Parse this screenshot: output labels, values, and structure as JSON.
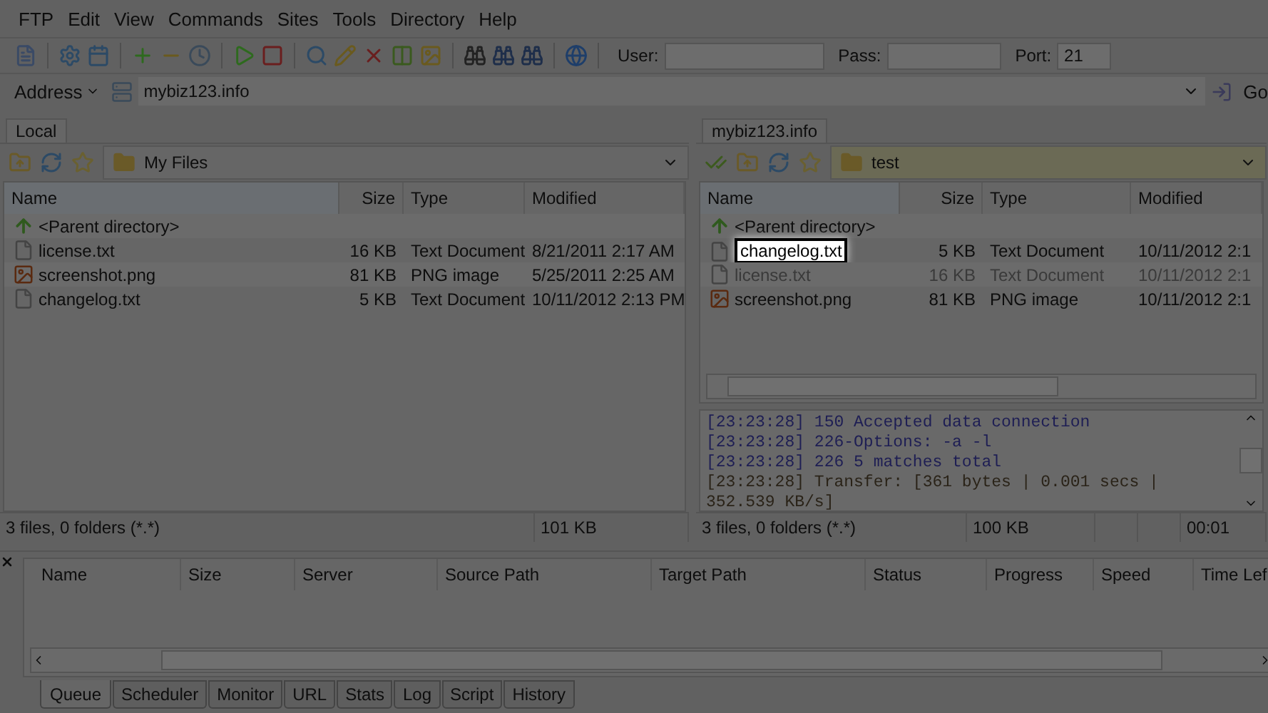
{
  "menu": [
    "FTP",
    "Edit",
    "View",
    "Commands",
    "Sites",
    "Tools",
    "Directory",
    "Help"
  ],
  "login": {
    "user_label": "User:",
    "pass_label": "Pass:",
    "port_label": "Port:",
    "port": "21"
  },
  "address": {
    "label": "Address",
    "value": "mybiz123.info",
    "go": "Go"
  },
  "local": {
    "tab": "Local",
    "path": "My Files",
    "highlight_path": false,
    "columns": [
      "Name",
      "Size",
      "Type",
      "Modified"
    ],
    "parent": "<Parent directory>",
    "rows": [
      {
        "name": "license.txt",
        "size": "16 KB",
        "type": "Text Document",
        "modified": "8/21/2011 2:17 AM",
        "kind": "text",
        "editing": false,
        "dimmed": false
      },
      {
        "name": "screenshot.png",
        "size": "81 KB",
        "type": "PNG image",
        "modified": "5/25/2011 2:25 AM",
        "kind": "image",
        "editing": false,
        "dimmed": false
      },
      {
        "name": "changelog.txt",
        "size": "5 KB",
        "type": "Text Document",
        "modified": "10/11/2012 2:13 PM",
        "kind": "text",
        "editing": false,
        "dimmed": false
      }
    ],
    "status": {
      "summary": "3 files, 0 folders (*.*)",
      "size": "101 KB"
    }
  },
  "remote": {
    "tab": "mybiz123.info",
    "path": "test",
    "highlight_path": true,
    "columns": [
      "Name",
      "Size",
      "Type",
      "Modified"
    ],
    "parent": "<Parent directory>",
    "rows": [
      {
        "name": "changelog.txt",
        "size": "5 KB",
        "type": "Text Document",
        "modified": "10/11/2012 2:1",
        "kind": "text",
        "editing": true,
        "dimmed": false
      },
      {
        "name": "license.txt",
        "size": "16 KB",
        "type": "Text Document",
        "modified": "10/11/2012 2:1",
        "kind": "text",
        "editing": false,
        "dimmed": true
      },
      {
        "name": "screenshot.png",
        "size": "81 KB",
        "type": "PNG image",
        "modified": "10/11/2012 2:1",
        "kind": "image",
        "editing": false,
        "dimmed": false
      }
    ],
    "log": [
      "[23:23:28] 150 Accepted data connection",
      "[23:23:28] 226-Options: -a -l",
      "[23:23:28] 226 5 matches total",
      "[23:23:28] Transfer: [361 bytes | 0.001 secs | 352.539 KB/s]"
    ],
    "status": {
      "summary": "3 files, 0 folders (*.*)",
      "size": "100 KB",
      "time": "00:01"
    }
  },
  "queue": {
    "columns": [
      "Name",
      "Size",
      "Server",
      "Source Path",
      "Target Path",
      "Status",
      "Progress",
      "Speed",
      "Time Lef"
    ],
    "tabs": [
      {
        "label": "Queue",
        "selected": true
      },
      {
        "label": "Scheduler",
        "selected": false
      },
      {
        "label": "Monitor",
        "selected": false
      },
      {
        "label": "URL",
        "selected": false
      },
      {
        "label": "Stats",
        "selected": false
      },
      {
        "label": "Log",
        "selected": false
      },
      {
        "label": "Script",
        "selected": false
      },
      {
        "label": "History",
        "selected": false
      }
    ]
  }
}
